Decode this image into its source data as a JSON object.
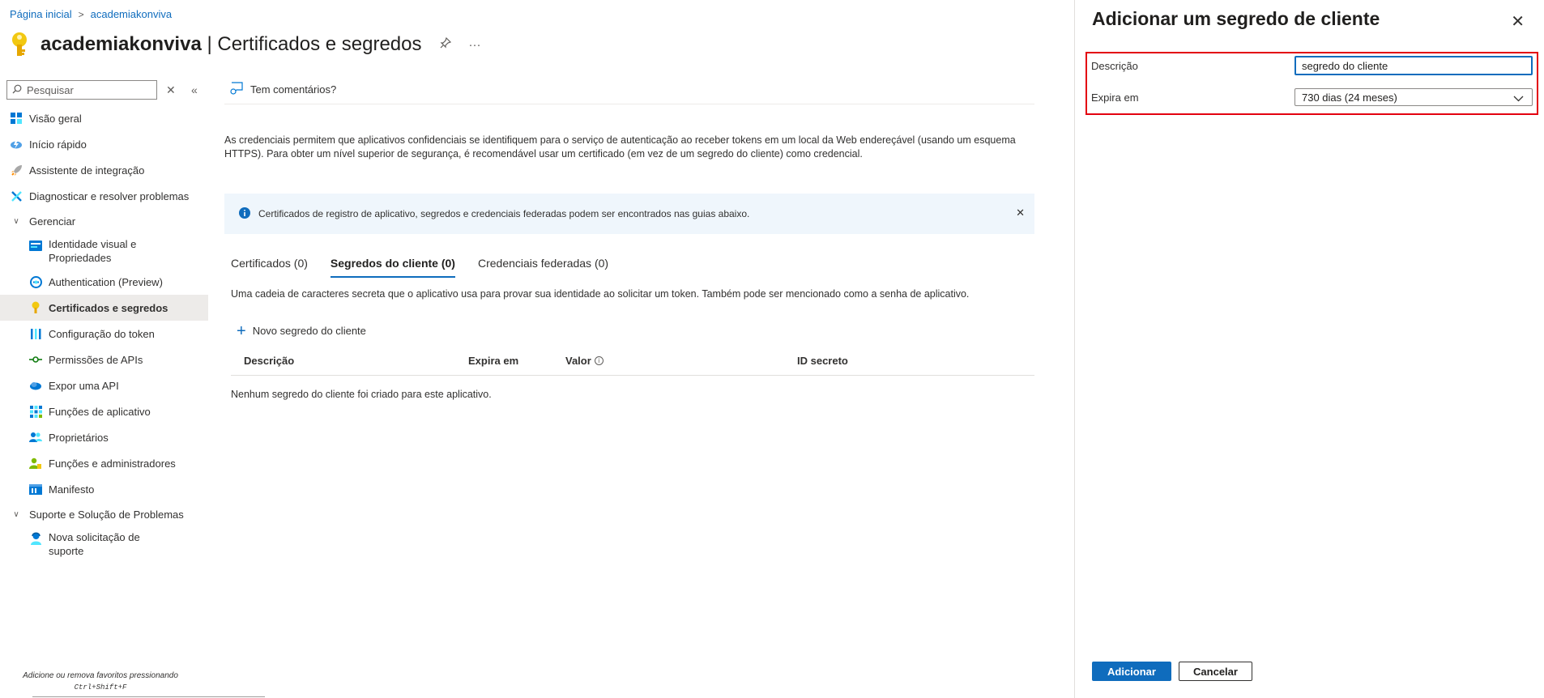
{
  "breadcrumb": {
    "home": "Página inicial",
    "current": "academiakonviva"
  },
  "header": {
    "app_name": "academiakonviva",
    "page_title": "| Certificados e segredos",
    "pin_icon": "pin-icon",
    "more_icon": "ellipsis-icon"
  },
  "search": {
    "placeholder": "Pesquisar"
  },
  "sidebar": {
    "items": [
      {
        "label": "Visão geral",
        "icon": "grid-icon"
      },
      {
        "label": "Início rápido",
        "icon": "cloud-lightning-icon"
      },
      {
        "label": "Assistente de integração",
        "icon": "rocket-icon"
      },
      {
        "label": "Diagnosticar e resolver problemas",
        "icon": "wrench-icon"
      }
    ],
    "group_manage": "Gerenciar",
    "manage_items": [
      {
        "label": "Identidade visual e Propriedades",
        "icon": "card-icon"
      },
      {
        "label": "Authentication (Preview)",
        "icon": "auth-icon"
      },
      {
        "label": "Certificados e segredos",
        "icon": "key-icon"
      },
      {
        "label": "Configuração do token",
        "icon": "bars-icon"
      },
      {
        "label": "Permissões de APIs",
        "icon": "api-icon"
      },
      {
        "label": "Expor uma API",
        "icon": "cloud-icon"
      },
      {
        "label": "Funções de aplicativo",
        "icon": "app-grid-icon"
      },
      {
        "label": "Proprietários",
        "icon": "people-icon"
      },
      {
        "label": "Funções e administradores",
        "icon": "admin-icon"
      },
      {
        "label": "Manifesto",
        "icon": "manifest-icon"
      }
    ],
    "group_support": "Suporte e Solução de Problemas",
    "support_items": [
      {
        "label": "Nova solicitação de suporte",
        "icon": "support-person-icon"
      }
    ],
    "fav_hint": "Adicione ou remova favoritos pressionando",
    "fav_shortcut": "Ctrl+Shift+F"
  },
  "main": {
    "feedback": "Tem comentários?",
    "intro": "As credenciais permitem que aplicativos confidenciais se identifiquem para o serviço de autenticação ao receber tokens em um local da Web endereçável (usando um esquema HTTPS). Para obter um nível superior de segurança, é recomendável usar um certificado (em vez de um segredo do cliente) como credencial.",
    "info_banner": "Certificados de registro de aplicativo, segredos e credenciais federadas podem ser encontrados nas guias abaixo.",
    "tabs": [
      {
        "label": "Certificados (0)"
      },
      {
        "label": "Segredos do cliente (0)"
      },
      {
        "label": "Credenciais federadas (0)"
      }
    ],
    "tab_description": "Uma cadeia de caracteres secreta que o aplicativo usa para provar sua identidade ao solicitar um token. Também pode ser mencionado como a senha de aplicativo.",
    "new_secret": "Novo segredo do cliente",
    "table": {
      "columns": [
        "Descrição",
        "Expira em",
        "Valor",
        "ID secreto"
      ],
      "empty": "Nenhum segredo do cliente foi criado para este aplicativo."
    }
  },
  "panel": {
    "title": "Adicionar um segredo de cliente",
    "description_label": "Descrição",
    "description_value": "segredo do cliente",
    "expires_label": "Expira em",
    "expires_value": "730 dias (24 meses)",
    "add_button": "Adicionar",
    "cancel_button": "Cancelar"
  },
  "colors": {
    "accent": "#0f6cbd",
    "highlight_frame": "#e3000f",
    "info_bg": "#eff6fc",
    "key_yellow": "#f2c811"
  }
}
